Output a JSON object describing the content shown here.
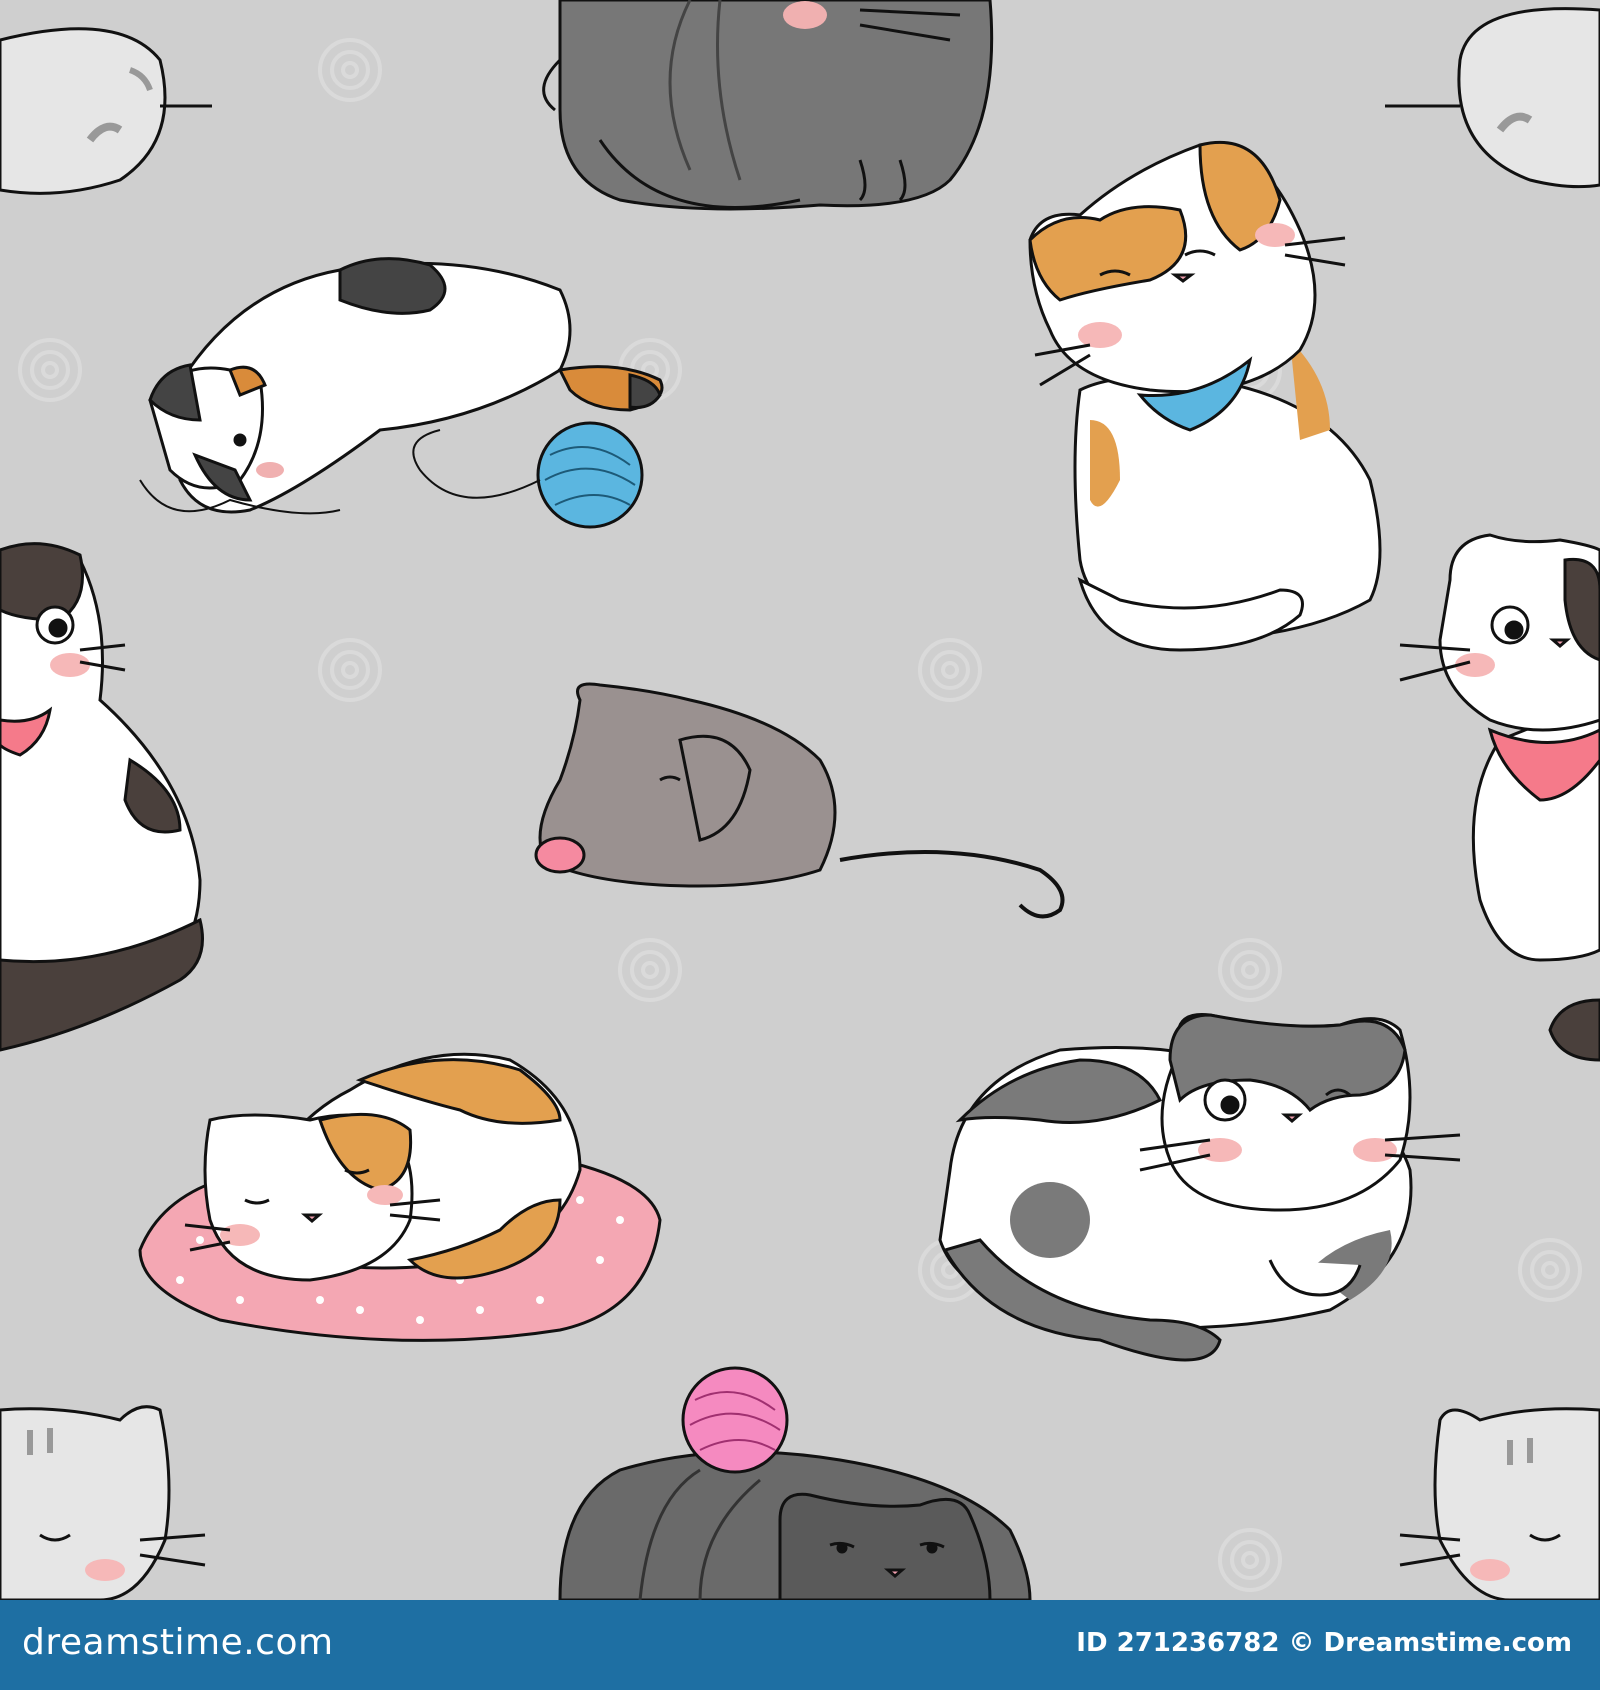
{
  "background_color": "#cfcfcf",
  "watermark": {
    "repeated_text": "dreamstime"
  },
  "footer": {
    "left_text": "dreamstime.com",
    "right_text": "ID 271236782 © Dreamstime.com",
    "bar_color": "#1e6fa3"
  },
  "illustrations": [
    {
      "name": "gray-cat-tangled-in-yarn"
    },
    {
      "name": "calico-cat-lying-with-blue-yarn"
    },
    {
      "name": "orange-white-cat-with-blue-bandana"
    },
    {
      "name": "black-white-cat-with-pink-bandana"
    },
    {
      "name": "gray-toy-mouse"
    },
    {
      "name": "calico-cat-sleeping-on-pink-pillow"
    },
    {
      "name": "gray-white-cat-lying-winking"
    },
    {
      "name": "dark-cat-with-pink-yarn"
    },
    {
      "name": "striped-gray-cat-corner"
    }
  ]
}
